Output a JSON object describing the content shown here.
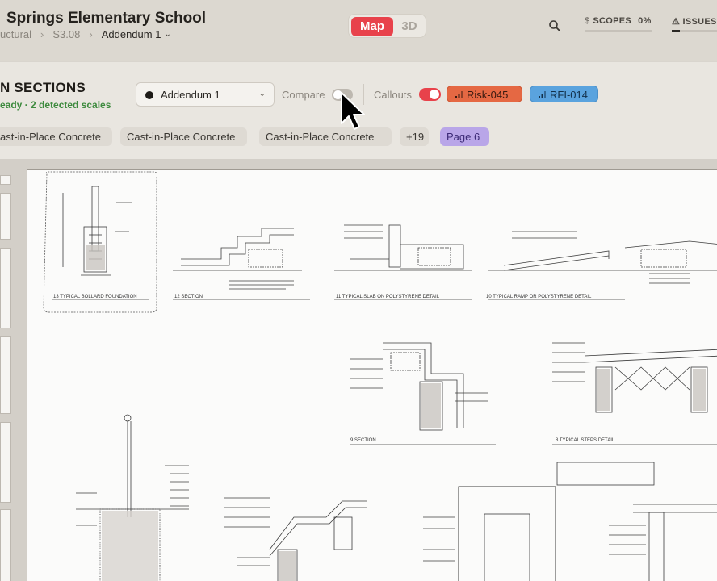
{
  "header": {
    "title": "Springs Elementary School",
    "breadcrumbs": [
      "uctural",
      "S3.08",
      "Addendum 1"
    ],
    "view_modes": [
      "Map",
      "3D"
    ],
    "active_view": "Map",
    "scopes_label": "SCOPES",
    "scopes_pct": "0%",
    "scopes_progress": 0,
    "issues_label": "ISSUES",
    "icons": [
      "search-icon",
      "dollar-icon",
      "warning-icon"
    ]
  },
  "toolbar": {
    "section_title": "N SECTIONS",
    "section_subtitle": "eady · 2 detected scales",
    "addendum_value": "Addendum 1",
    "compare_label": "Compare",
    "compare_on": false,
    "callouts_label": "Callouts",
    "callouts_on": true,
    "callout_pills": [
      {
        "label": "Risk-045",
        "color": "#e56843"
      },
      {
        "label": "RFI-014",
        "color": "#5aa3de"
      }
    ],
    "spec_chips": [
      "ast-in-Place Concrete",
      "Cast-in-Place Concrete",
      "Cast-in-Place Concrete"
    ],
    "more_chip": "+19",
    "page_chip": "Page 6"
  },
  "colors": {
    "accent_red": "#e8424b",
    "success_green": "#3d8a3e",
    "page_chip": "#b9a6e8"
  },
  "drawing": {
    "details": [
      {
        "num": "13",
        "title": "TYPICAL BOLLARD FOUNDATION"
      },
      {
        "num": "12",
        "title": "SECTION"
      },
      {
        "num": "11",
        "title": "TYPICAL SLAB ON POLYSTYRENE DETAIL"
      },
      {
        "num": "10",
        "title": "TYPICAL RAMP OR POLYSTYRENE DETAIL"
      },
      {
        "num": "9",
        "title": "SECTION"
      },
      {
        "num": "8",
        "title": "TYPICAL STEPS DETAIL"
      }
    ]
  }
}
